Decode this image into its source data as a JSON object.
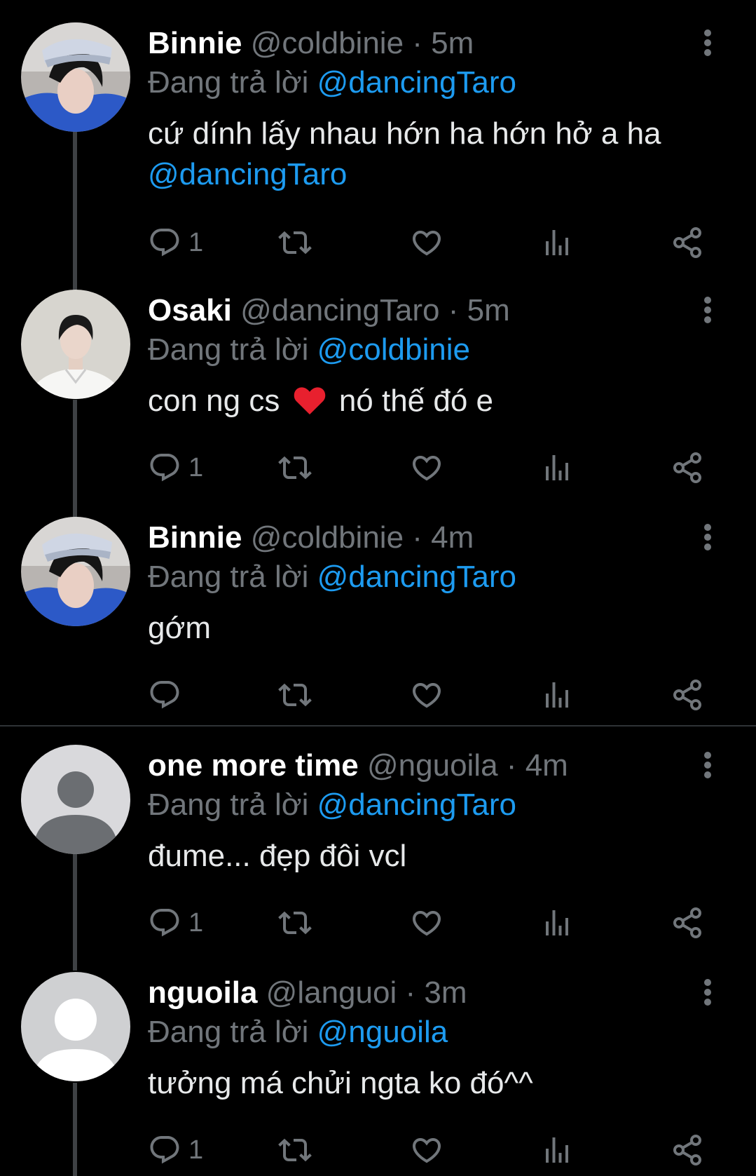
{
  "tweets": [
    {
      "name": "Binnie",
      "handle": "@coldbinie",
      "dot": "·",
      "time": "5m",
      "reply_prefix": "Đang trả lời",
      "reply_to": "@dancingTaro",
      "text_line1": "cứ dính lấy nhau hớn ha hớn hở a ha",
      "text_mention": "@dancingTaro",
      "reply_count": "1",
      "avatar": "photo-user-cap"
    },
    {
      "name": "Osaki",
      "handle": "@dancingTaro",
      "dot": "·",
      "time": "5m",
      "reply_prefix": "Đang trả lời",
      "reply_to": "@coldbinie",
      "text_before": "con ng cs",
      "emoji": "red-heart-emoji",
      "text_after": "nó thế đó e",
      "reply_count": "1",
      "avatar": "photo-user-white-shirt"
    },
    {
      "name": "Binnie",
      "handle": "@coldbinie",
      "dot": "·",
      "time": "4m",
      "reply_prefix": "Đang trả lời",
      "reply_to": "@dancingTaro",
      "text_line1": "gớm",
      "reply_count": "",
      "avatar": "photo-user-cap"
    },
    {
      "name": "one more time",
      "handle": "@nguoila",
      "dot": "·",
      "time": "4m",
      "reply_prefix": "Đang trả lời",
      "reply_to": "@dancingTaro",
      "text_line1": "đume... đẹp đôi vcl",
      "reply_count": "1",
      "avatar": "default-avatar-gray"
    },
    {
      "name": "nguoila",
      "handle": "@languoi",
      "dot": "·",
      "time": "3m",
      "reply_prefix": "Đang trả lời",
      "reply_to": "@nguoila",
      "text_line1": "tưởng má chửi ngta ko đó^^",
      "reply_count": "1",
      "avatar": "default-avatar-light"
    }
  ],
  "icons": {
    "reply": "reply-icon",
    "retweet": "retweet-icon",
    "like": "heart-icon",
    "views": "views-icon",
    "share": "share-icon",
    "more": "more-vertical-icon"
  },
  "colors": {
    "background": "#000000",
    "text": "#e7e9ea",
    "secondary": "#71767b",
    "accent": "#1d9bf0",
    "heart": "#e8202e"
  }
}
